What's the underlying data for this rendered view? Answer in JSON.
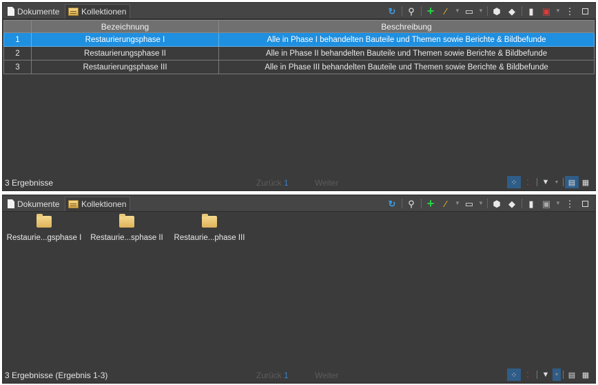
{
  "tabs": {
    "documents": "Dokumente",
    "collections": "Kollektionen"
  },
  "table": {
    "columns": [
      "Bezeichnung",
      "Beschreibung"
    ],
    "rows": [
      {
        "num": "1",
        "name": "Restaurierungsphase I",
        "desc": "Alle in Phase I behandelten Bauteile und Themen sowie Berichte & Bildbefunde",
        "selected": true
      },
      {
        "num": "2",
        "name": "Restaurierungsphase II",
        "desc": "Alle in Phase II behandelten Bauteile und Themen sowie Berichte & Bildbefunde"
      },
      {
        "num": "3",
        "name": "Restaurierungsphase III",
        "desc": "Alle in Phase III behandelten Bauteile und Themen sowie Berichte & Bildbefunde"
      }
    ]
  },
  "top_status": {
    "results": "3 Ergebnisse",
    "back": "Zurück",
    "page": "1",
    "next": "Weiter"
  },
  "folders": [
    {
      "label": "Restaurie...gsphase I"
    },
    {
      "label": "Restaurie...sphase II"
    },
    {
      "label": "Restaurie...phase III"
    }
  ],
  "bottom_status": {
    "results": "3 Ergebnisse (Ergebnis 1-3)",
    "back": "Zurück",
    "page": "1",
    "next": "Weiter"
  },
  "colors": {
    "selection": "#1f8fe0",
    "add": "#27d247",
    "refresh": "#3a9ee8",
    "pdf": "#e53935"
  },
  "icons": [
    "document-icon",
    "collection-icon",
    "refresh-icon",
    "search-icon",
    "plus-icon",
    "pen-icon",
    "link-icon",
    "cube-icon",
    "tag-icon",
    "copy-icon",
    "pdf-icon",
    "more-icon",
    "window-icon",
    "layout-icon",
    "filter-icon",
    "table-view-icon",
    "grid-view-icon"
  ]
}
